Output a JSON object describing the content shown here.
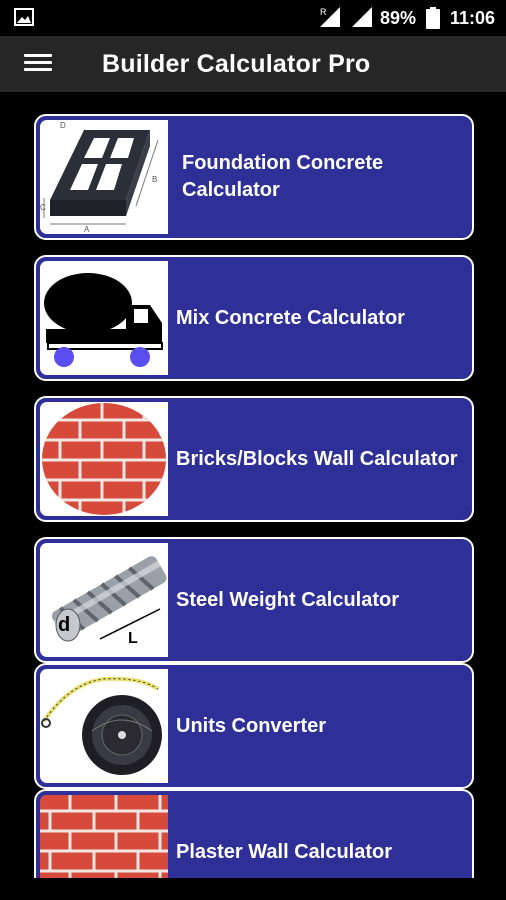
{
  "status_bar": {
    "battery_percent": "89%",
    "time": "11:06",
    "roaming_indicator": "R"
  },
  "app_bar": {
    "title": "Builder Calculator Pro",
    "menu_icon": "hamburger-menu-icon"
  },
  "calculators": [
    {
      "label": "Foundation Concrete Calculator",
      "icon": "foundation-icon"
    },
    {
      "label": "Mix Concrete Calculator",
      "icon": "concrete-mixer-truck-icon"
    },
    {
      "label": "Bricks/Blocks Wall Calculator",
      "icon": "brick-wall-icon"
    },
    {
      "label": "Steel Weight Calculator",
      "icon": "steel-rebar-icon"
    },
    {
      "label": "Units Converter",
      "icon": "measuring-tape-icon"
    },
    {
      "label": "Plaster Wall Calculator",
      "icon": "plaster-wall-icon"
    }
  ],
  "colors": {
    "card_background": "#2f2f98",
    "app_bar": "#262626",
    "background": "#000000"
  }
}
